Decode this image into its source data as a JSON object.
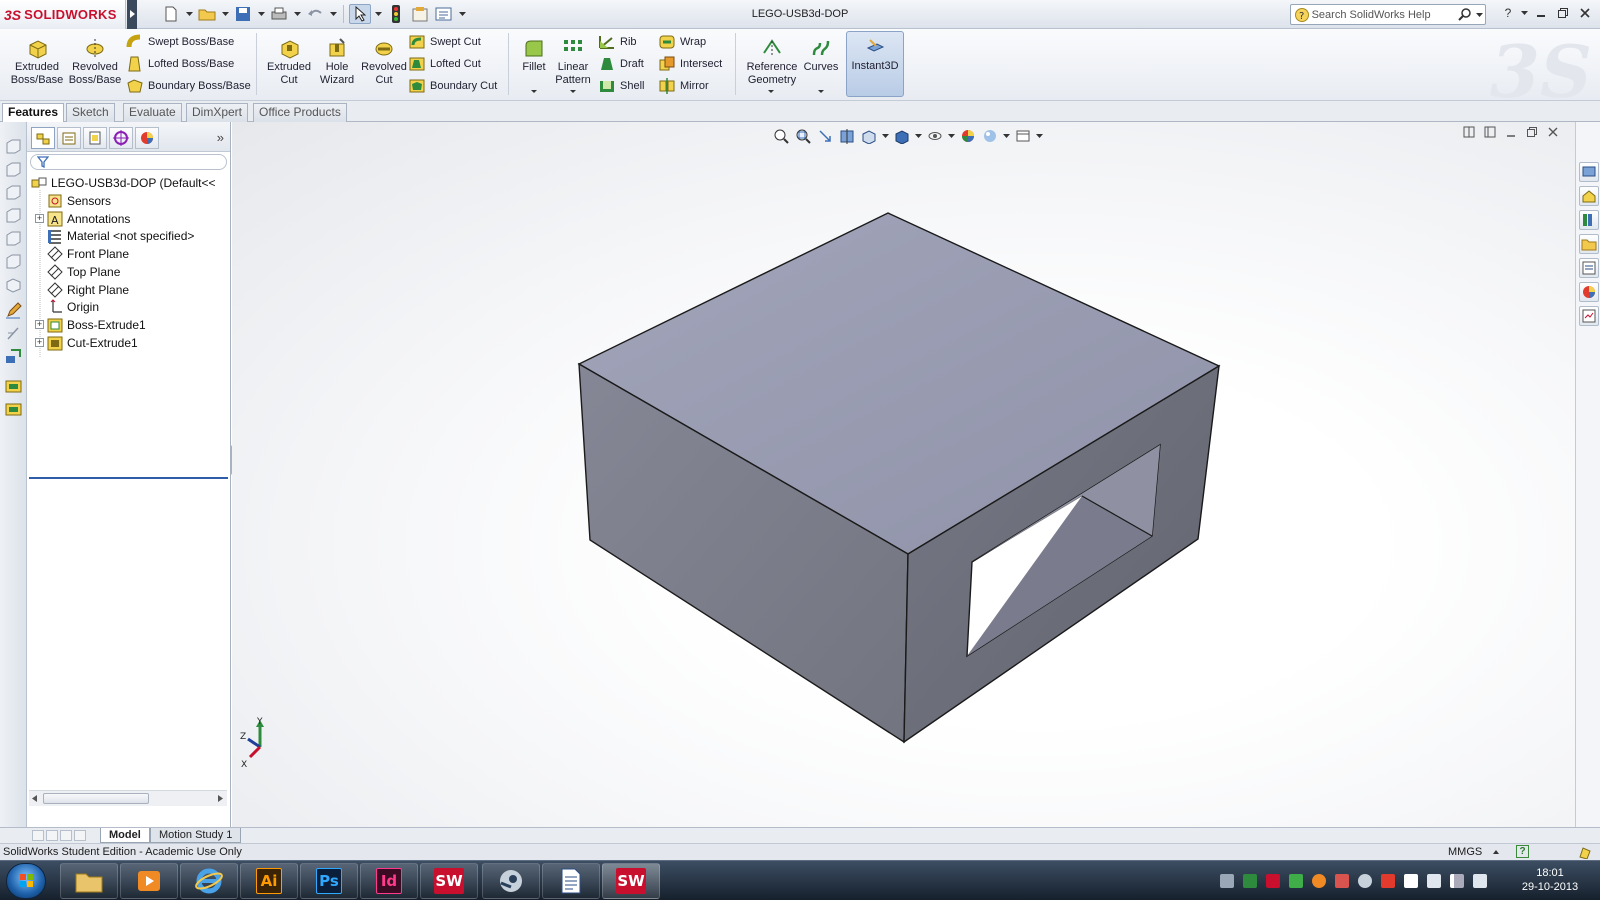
{
  "app": {
    "logo_ds": "3S",
    "logo_text": "SOLIDWORKS",
    "document_title": "LEGO-USB3d-DOP",
    "help_search_placeholder": "Search SolidWorks Help"
  },
  "command_manager": {
    "extruded_boss": "Extruded Boss/Base",
    "revolved_boss": "Revolved Boss/Base",
    "swept_boss": "Swept Boss/Base",
    "lofted_boss": "Lofted Boss/Base",
    "boundary_boss": "Boundary Boss/Base",
    "extruded_cut": "Extruded Cut",
    "hole_wizard": "Hole Wizard",
    "revolved_cut": "Revolved Cut",
    "swept_cut": "Swept Cut",
    "lofted_cut": "Lofted Cut",
    "boundary_cut": "Boundary Cut",
    "fillet": "Fillet",
    "linear_pattern": "Linear Pattern",
    "rib": "Rib",
    "draft": "Draft",
    "shell": "Shell",
    "wrap": "Wrap",
    "intersect": "Intersect",
    "mirror": "Mirror",
    "reference_geometry": "Reference Geometry",
    "curves": "Curves",
    "instant3d": "Instant3D"
  },
  "tabs": [
    "Features",
    "Sketch",
    "Evaluate",
    "DimXpert",
    "Office Products"
  ],
  "feature_tree": {
    "root": "LEGO-USB3d-DOP  (Default<<",
    "items": [
      {
        "label": "Sensors",
        "icon": "sensor-icon",
        "expandable": false
      },
      {
        "label": "Annotations",
        "icon": "annotation-icon",
        "expandable": true
      },
      {
        "label": "Material <not specified>",
        "icon": "material-icon",
        "expandable": false
      },
      {
        "label": "Front Plane",
        "icon": "plane-icon",
        "expandable": false
      },
      {
        "label": "Top Plane",
        "icon": "plane-icon",
        "expandable": false
      },
      {
        "label": "Right Plane",
        "icon": "plane-icon",
        "expandable": false
      },
      {
        "label": "Origin",
        "icon": "origin-icon",
        "expandable": false
      },
      {
        "label": "Boss-Extrude1",
        "icon": "boss-extrude-icon",
        "expandable": true
      },
      {
        "label": "Cut-Extrude1",
        "icon": "cut-extrude-icon",
        "expandable": true
      }
    ]
  },
  "triad": {
    "x": "X",
    "y": "Y",
    "z": "Z"
  },
  "bottom_tabs": [
    "Model",
    "Motion Study 1"
  ],
  "status": {
    "text": "SolidWorks Student Edition - Academic Use Only",
    "units": "MMGS",
    "help": "?"
  },
  "taskbar": {
    "apps": [
      {
        "label": "Ai",
        "name": "illustrator"
      },
      {
        "label": "Ps",
        "name": "photoshop"
      },
      {
        "label": "Id",
        "name": "indesign"
      },
      {
        "label": "SW",
        "name": "solidworks-pinned"
      },
      {
        "label": "SW",
        "name": "solidworks-running"
      }
    ],
    "time": "18:01",
    "date": "29-10-2013"
  },
  "colors": {
    "brand_red": "#c8102e",
    "model_top": "#9a9db2",
    "model_left": "#7b7d8c",
    "model_right": "#6d6f7d",
    "selection_blue": "#2f5ea8"
  }
}
